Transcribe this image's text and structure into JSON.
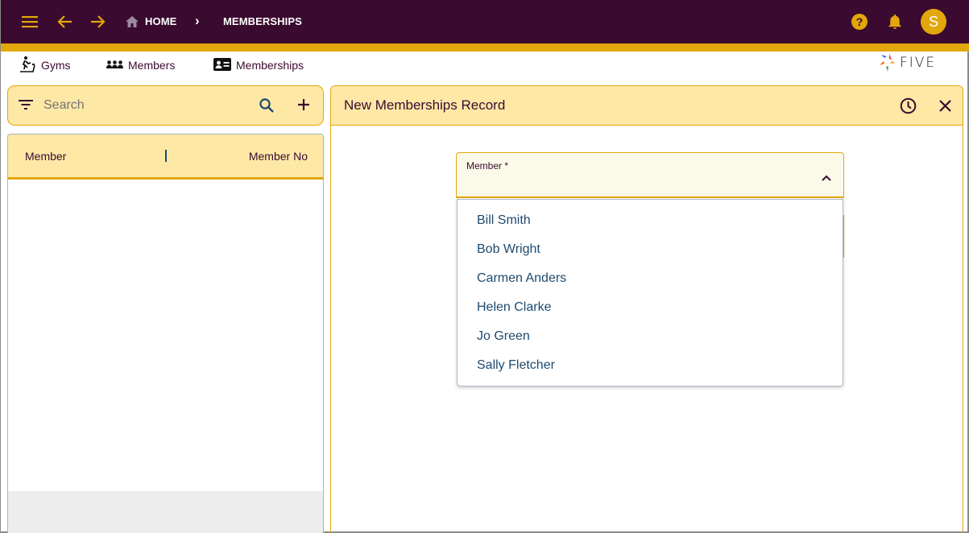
{
  "topbar": {
    "menu_icon": "hamburger-menu-icon",
    "back_icon": "arrow-left-icon",
    "forward_icon": "arrow-right-icon",
    "breadcrumb": {
      "home_icon": "home-icon",
      "home_label": "HOME",
      "separator": "›",
      "current_label": "MEMBERSHIPS"
    },
    "help_icon": "help-circle-icon",
    "notifications_icon": "bell-icon",
    "avatar_initial": "S"
  },
  "navbar": {
    "items": [
      {
        "label": "Gyms",
        "icon": "treadmill-icon"
      },
      {
        "label": "Members",
        "icon": "people-icon"
      },
      {
        "label": "Memberships",
        "icon": "id-card-icon"
      }
    ],
    "logo_text": "FIVE"
  },
  "list_panel": {
    "search_placeholder": "Search",
    "filter_icon": "filter-icon",
    "search_icon": "search-icon",
    "add_icon": "plus-icon",
    "columns": [
      "Member",
      "Member No"
    ],
    "rows": []
  },
  "record_panel": {
    "title": "New Memberships Record",
    "history_icon": "clock-icon",
    "close_icon": "close-icon",
    "member_field": {
      "label": "Member *",
      "value": "",
      "expanded": true,
      "options": [
        "Bill Smith",
        "Bob Wright",
        "Carmen Anders",
        "Helen Clarke",
        "Jo Green",
        "Sally Fletcher"
      ]
    }
  },
  "colors": {
    "topbar": "#3a0a30",
    "accent": "#e2a70a",
    "header_fill": "#fde8a6",
    "field_fill": "#fbfae8",
    "option_text": "#1e4a6e"
  }
}
